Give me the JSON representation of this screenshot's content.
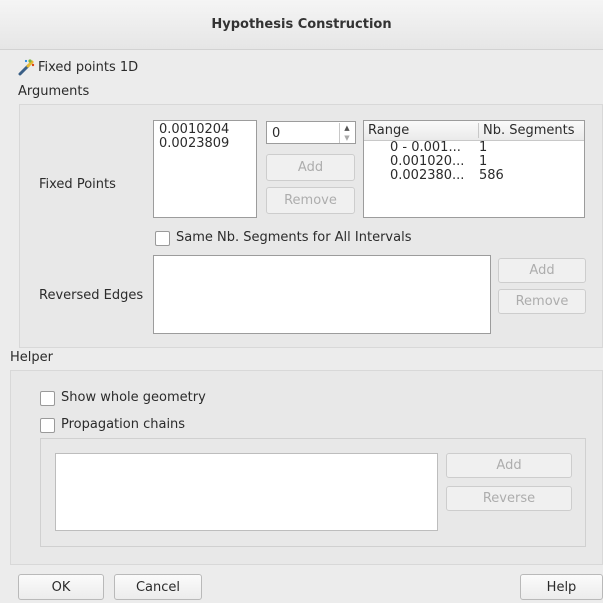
{
  "window": {
    "title": "Hypothesis Construction"
  },
  "hypothesis": {
    "icon": "wand-icon",
    "name": "Fixed points 1D"
  },
  "arguments": {
    "heading": "Arguments",
    "fixed_points": {
      "label": "Fixed Points",
      "values": [
        "0.0010204",
        "0.0023809"
      ],
      "spin_value": "0",
      "add_label": "Add",
      "remove_label": "Remove",
      "table": {
        "headers": [
          "Range",
          "Nb. Segments"
        ],
        "rows": [
          [
            "0 - 0.001...",
            "1"
          ],
          [
            "0.001020...",
            "1"
          ],
          [
            "0.002380...",
            "586"
          ]
        ]
      }
    },
    "same_nb_segments": {
      "label": "Same Nb. Segments for All Intervals",
      "checked": false
    },
    "reversed_edges": {
      "label": "Reversed Edges",
      "add_label": "Add",
      "remove_label": "Remove"
    }
  },
  "helper": {
    "heading": "Helper",
    "show_whole_geometry": {
      "label": "Show whole geometry",
      "checked": false
    },
    "propagation_chains": {
      "label": "Propagation chains",
      "checked": false
    },
    "add_label": "Add",
    "reverse_label": "Reverse"
  },
  "footer": {
    "ok_label": "OK",
    "cancel_label": "Cancel",
    "help_label": "Help"
  }
}
